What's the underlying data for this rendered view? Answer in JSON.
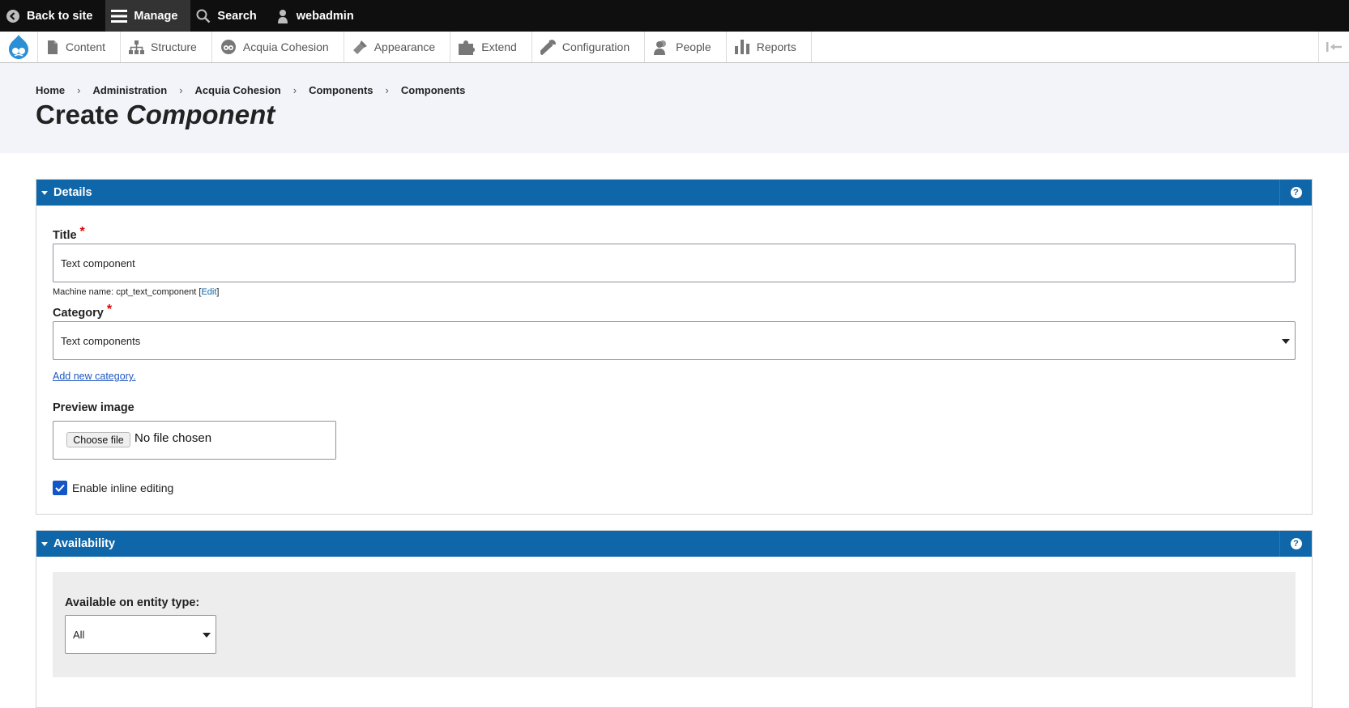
{
  "toolbar": {
    "back_label": "Back to site",
    "manage_label": "Manage",
    "search_label": "Search",
    "user_label": "webadmin"
  },
  "admin_menu": {
    "items": [
      {
        "label": "Content",
        "icon": "file-icon"
      },
      {
        "label": "Structure",
        "icon": "sitemap-icon"
      },
      {
        "label": "Acquia Cohesion",
        "icon": "cohesion-icon"
      },
      {
        "label": "Appearance",
        "icon": "paintbrush-icon"
      },
      {
        "label": "Extend",
        "icon": "puzzle-icon"
      },
      {
        "label": "Configuration",
        "icon": "wrench-icon"
      },
      {
        "label": "People",
        "icon": "people-icon"
      },
      {
        "label": "Reports",
        "icon": "bar-chart-icon"
      }
    ]
  },
  "breadcrumb": [
    "Home",
    "Administration",
    "Acquia Cohesion",
    "Components",
    "Components"
  ],
  "page_title": {
    "prefix": "Create",
    "emphasis": "Component"
  },
  "details": {
    "heading": "Details",
    "title_label": "Title",
    "title_value": "Text component",
    "machine_name_prefix": "Machine name: cpt_text_component [",
    "machine_name_edit": "Edit",
    "machine_name_suffix": "]",
    "category_label": "Category",
    "category_value": "Text components",
    "add_category_link": "Add new category.",
    "preview_label": "Preview image",
    "choose_file_label": "Choose file",
    "no_file_text": "No file chosen",
    "inline_editing_label": "Enable inline editing",
    "inline_editing_checked": true
  },
  "availability": {
    "heading": "Availability",
    "entity_type_label": "Available on entity type:",
    "entity_type_value": "All"
  },
  "colors": {
    "toolbar_bg": "#0f0f0f",
    "panel_header": "#0f66a9",
    "header_bg": "#f3f4f9",
    "checkbox": "#1456c5"
  }
}
